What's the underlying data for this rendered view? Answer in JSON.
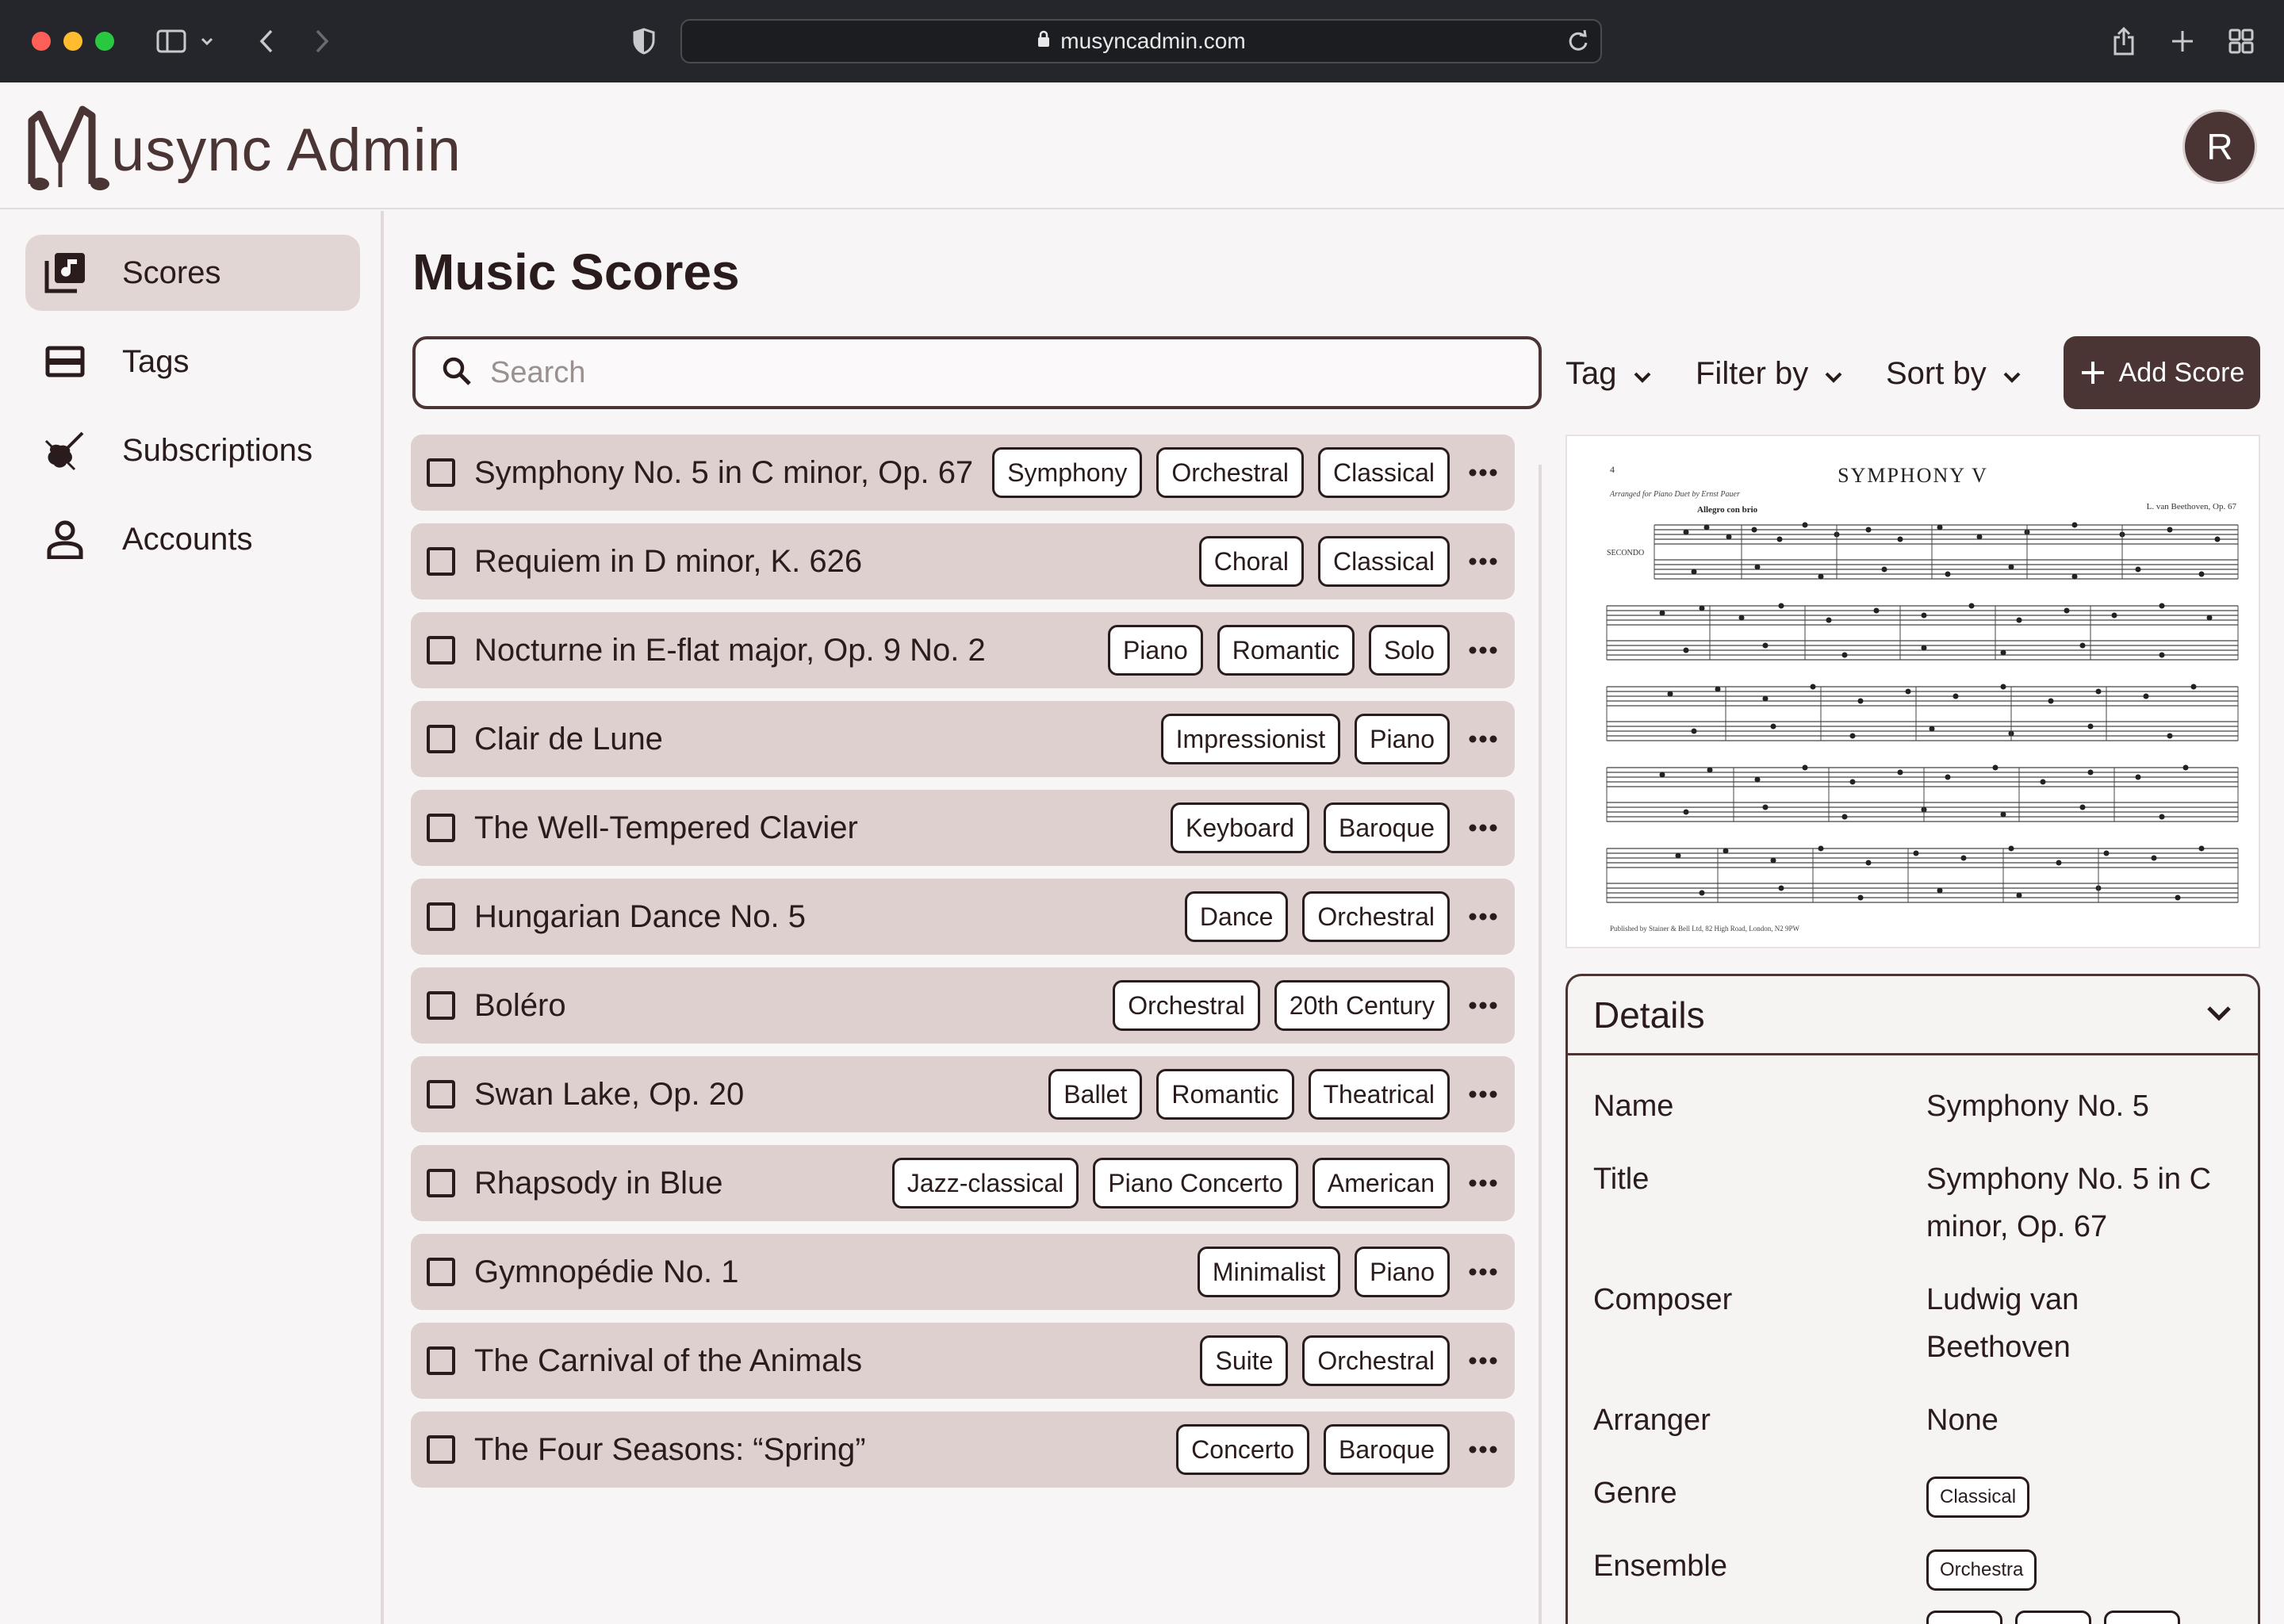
{
  "browser": {
    "url": "musyncadmin.com"
  },
  "header": {
    "app_name": "usync Admin",
    "avatar_initial": "R"
  },
  "sidebar": {
    "items": [
      {
        "label": "Scores",
        "icon": "music-library-icon",
        "active": true
      },
      {
        "label": "Tags",
        "icon": "tags-icon",
        "active": false
      },
      {
        "label": "Subscriptions",
        "icon": "violin-icon",
        "active": false
      },
      {
        "label": "Accounts",
        "icon": "person-icon",
        "active": false
      }
    ]
  },
  "main": {
    "title": "Music Scores",
    "search_placeholder": "Search",
    "tag_label": "Tag",
    "filter_label": "Filter by",
    "sort_label": "Sort by",
    "add_label": "Add Score"
  },
  "scores": [
    {
      "title": "Symphony No. 5 in C minor, Op. 67",
      "tags": [
        "Symphony",
        "Orchestral",
        "Classical"
      ]
    },
    {
      "title": "Requiem in D minor, K. 626",
      "tags": [
        "Choral",
        "Classical"
      ]
    },
    {
      "title": "Nocturne in E-flat major, Op. 9 No. 2",
      "tags": [
        "Piano",
        "Romantic",
        "Solo"
      ]
    },
    {
      "title": "Clair de Lune",
      "tags": [
        "Impressionist",
        "Piano"
      ]
    },
    {
      "title": "The Well-Tempered Clavier",
      "tags": [
        "Keyboard",
        "Baroque"
      ]
    },
    {
      "title": "Hungarian Dance No. 5",
      "tags": [
        "Dance",
        "Orchestral"
      ]
    },
    {
      "title": "Boléro",
      "tags": [
        "Orchestral",
        "20th Century"
      ]
    },
    {
      "title": "Swan Lake, Op. 20",
      "tags": [
        "Ballet",
        "Romantic",
        "Theatrical"
      ]
    },
    {
      "title": "Rhapsody in Blue",
      "tags": [
        "Jazz-classical",
        "Piano Concerto",
        "American"
      ]
    },
    {
      "title": "Gymnopédie No. 1",
      "tags": [
        "Minimalist",
        "Piano"
      ]
    },
    {
      "title": "The Carnival of the Animals",
      "tags": [
        "Suite",
        "Orchestral"
      ]
    },
    {
      "title": "The Four Seasons: “Spring”",
      "tags": [
        "Concerto",
        "Baroque"
      ]
    }
  ],
  "preview": {
    "page_number": "4",
    "score_title": "SYMPHONY V",
    "arranged_by": "Arranged for Piano Duet by Ernst Pauer",
    "composer_credit": "L. van Beethoven, Op. 67",
    "tempo": "Allegro con brio",
    "part": "SECONDO",
    "publisher": "Published by Stainer & Bell Ltd, 82 High Road, London, N2 9PW"
  },
  "details": {
    "heading": "Details",
    "fields": {
      "name_label": "Name",
      "name_value": "Symphony No. 5",
      "title_label": "Title",
      "title_value": "Symphony No. 5 in C minor, Op. 67",
      "composer_label": "Composer",
      "composer_value": "Ludwig van Beethoven",
      "arranger_label": "Arranger",
      "arranger_value": "None",
      "genre_label": "Genre",
      "genre_value": "Classical",
      "ensemble_label": "Ensemble",
      "ensemble_value": "Orchestra"
    }
  },
  "colors": {
    "brand": "#4a3434",
    "row_bg": "#ddd0ce",
    "active_nav": "#e2d6d4"
  }
}
